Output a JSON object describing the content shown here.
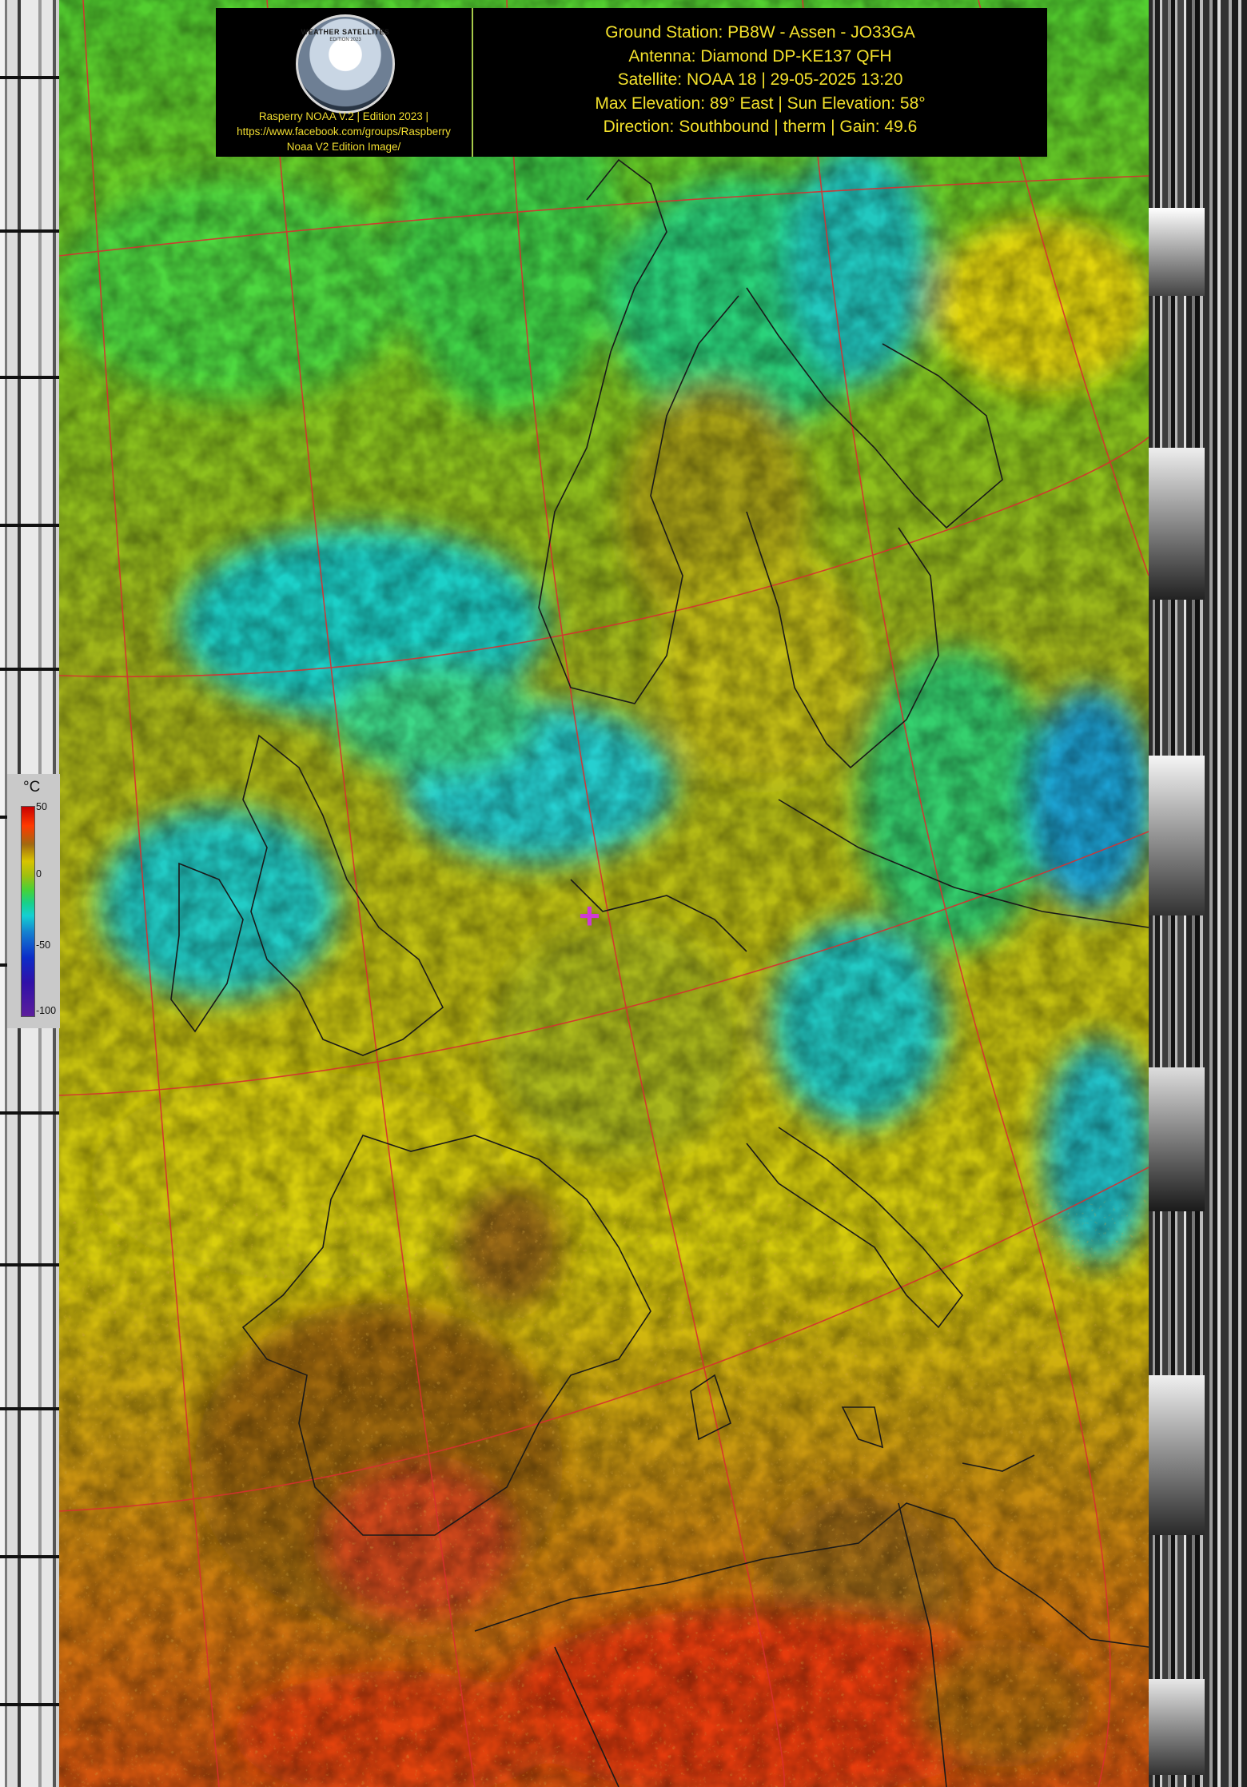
{
  "header": {
    "logo_text": "WEATHER SATELLITES",
    "logo_subtext": "EDITION 2023",
    "caption_lines": [
      "Rasperry NOAA V.2 | Edition 2023 |",
      "https://www.facebook.com/groups/Raspberry",
      "Noaa V2 Edition Image/"
    ],
    "info_lines": [
      "Ground Station: PB8W - Assen - JO33GA",
      "Antenna: Diamond DP-KE137 QFH",
      "Satellite: NOAA 18 | 29-05-2025 13:20",
      "Max Elevation: 89° East | Sun Elevation: 58°",
      "Direction: Southbound | therm | Gain: 49.6"
    ]
  },
  "legend": {
    "unit": "°C",
    "labels": [
      "50",
      "0",
      "-50",
      "-100"
    ]
  },
  "colors": {
    "hot": "#e83a10",
    "warm_brown": "#9a6810",
    "mild_yellow": "#d8cc10",
    "olive": "#a8a818",
    "green": "#46d232",
    "cyan": "#18d0d0",
    "blue": "#1464d0",
    "grid": "#d83030",
    "coast": "#1a1a1a",
    "marker": "#d13ad6",
    "header_text": "#f2e02c"
  }
}
